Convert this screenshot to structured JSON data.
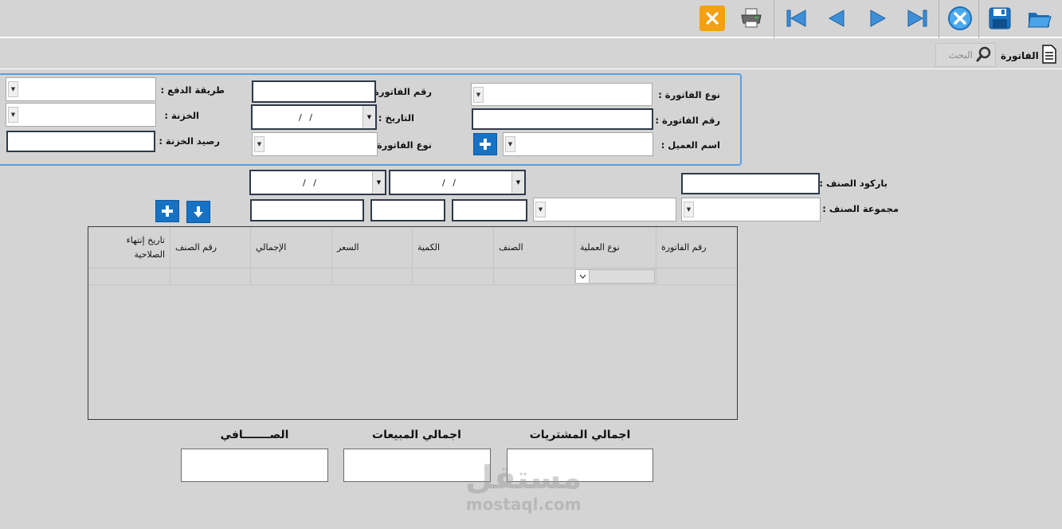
{
  "toolbar": {
    "buttons": [
      {
        "name": "open-folder-icon"
      },
      {
        "name": "save-icon"
      },
      {
        "name": "delete-icon"
      },
      {
        "name": "last-record-icon"
      },
      {
        "name": "next-record-icon"
      },
      {
        "name": "previous-record-icon"
      },
      {
        "name": "first-record-icon"
      },
      {
        "name": "printer-icon"
      },
      {
        "name": "close-icon"
      }
    ],
    "colors": {
      "blue": "#1772c4",
      "orange": "#f5a00f"
    }
  },
  "tab": {
    "title": "الفاتورة",
    "search_placeholder": "البحث"
  },
  "header_form": {
    "invoice_type_label": "نوع الفاتورة :",
    "invoice_no_label": "رقم الفاتورة :",
    "customer_name_label": "اسم العميل :",
    "invoice_no2_label": "رقم الفاتورة",
    "date_label": "التاريخ :",
    "invoice_type2_label": "نوع الفاتورة",
    "date_value": "/   /",
    "payment_method_label": "طريقة الدفع :",
    "treasury_label": "الخزنة :",
    "treasury_balance_label": "رصيد الخزنة :"
  },
  "item_form": {
    "barcode_label": "باركود الصنف :",
    "group_label": "مجموعة الصنف :",
    "date_from": "/   /",
    "date_to": "/   /"
  },
  "grid": {
    "columns": [
      "رقم الفاتورة",
      "نوع العملية",
      "الصنف",
      "الكمية",
      "السعر",
      "الإجمالي",
      "رقم الصنف",
      "تاريخ إنتهاء الصلاحية"
    ]
  },
  "totals": {
    "purchases_label": "اجمالي  المشتريات",
    "sales_label": "اجمالي المبيعات",
    "net_label": "الصـــــــافي"
  },
  "watermark": {
    "brand": "مستقل",
    "site": "mostaql.com"
  }
}
